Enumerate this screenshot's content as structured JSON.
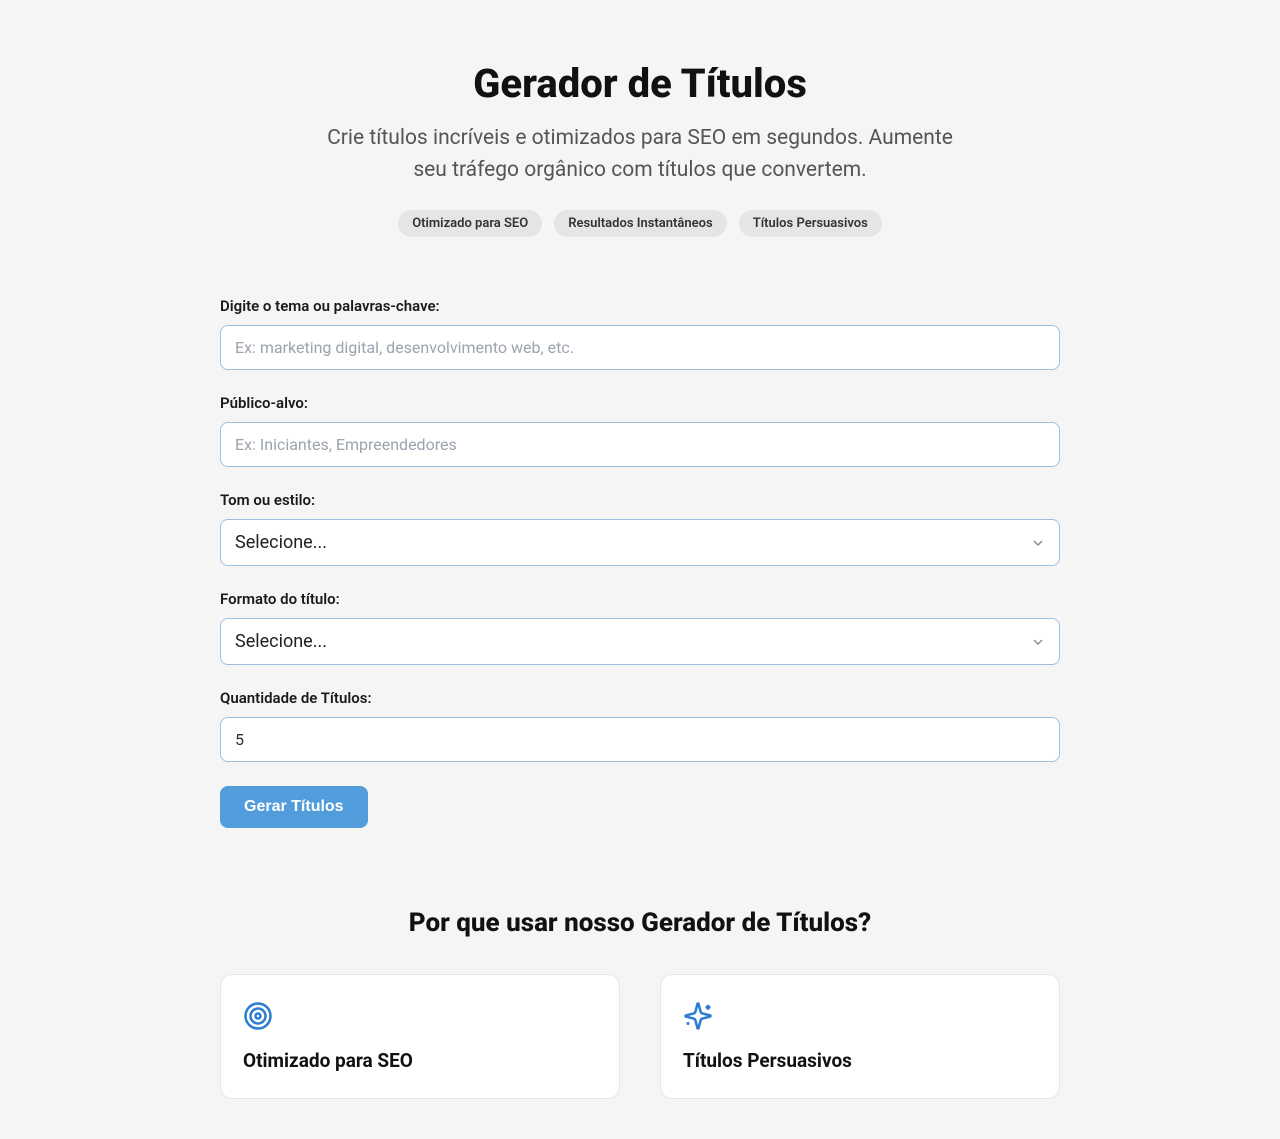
{
  "header": {
    "title": "Gerador de Títulos",
    "subtitle": "Crie títulos incríveis e otimizados para SEO em segundos. Aumente seu tráfego orgânico com títulos que convertem.",
    "pills": [
      "Otimizado para SEO",
      "Resultados Instantâneos",
      "Títulos Persuasivos"
    ]
  },
  "form": {
    "keywords_label": "Digite o tema ou palavras-chave:",
    "keywords_placeholder": "Ex: marketing digital, desenvolvimento web, etc.",
    "audience_label": "Público-alvo:",
    "audience_placeholder": "Ex: Iniciantes, Empreendedores",
    "tone_label": "Tom ou estilo:",
    "tone_selected": "Selecione...",
    "format_label": "Formato do título:",
    "format_selected": "Selecione...",
    "quantity_label": "Quantidade de Títulos:",
    "quantity_value": "5",
    "submit_label": "Gerar Títulos"
  },
  "why": {
    "title": "Por que usar nosso Gerador de Títulos?",
    "cards": [
      {
        "title": "Otimizado para SEO"
      },
      {
        "title": "Títulos Persuasivos"
      }
    ]
  }
}
